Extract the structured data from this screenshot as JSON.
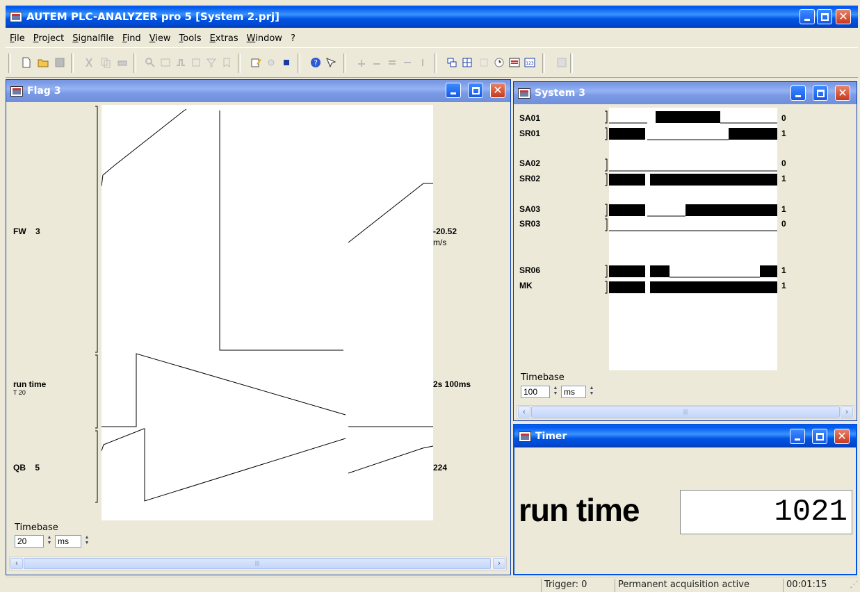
{
  "app": {
    "title": "AUTEM PLC-ANALYZER pro 5 [System 2.prj]"
  },
  "menu": [
    "File",
    "Project",
    "Signalfile",
    "Find",
    "View",
    "Tools",
    "Extras",
    "Window",
    "?"
  ],
  "windows": {
    "flag": {
      "title": "Flag 3",
      "signals": [
        {
          "name": "FW",
          "number": "3",
          "value": "-20.52",
          "unit": "m/s"
        },
        {
          "name": "run time",
          "sub": "T 20",
          "value": "2s 100ms"
        },
        {
          "name": "QB",
          "number": "5",
          "value": "224"
        }
      ],
      "timebase_label": "Timebase",
      "timebase_value": "20",
      "timebase_unit": "ms"
    },
    "system": {
      "title": "System 3",
      "signals": [
        {
          "name": "SA01",
          "value": "0"
        },
        {
          "name": "SR01",
          "value": "1"
        },
        {
          "name": "SA02",
          "value": "0"
        },
        {
          "name": "SR02",
          "value": "1"
        },
        {
          "name": "SA03",
          "value": "1"
        },
        {
          "name": "SR03",
          "value": "0"
        },
        {
          "name": "SR06",
          "value": "1"
        },
        {
          "name": "MK",
          "value": "1"
        }
      ],
      "timebase_label": "Timebase",
      "timebase_value": "100",
      "timebase_unit": "ms"
    },
    "timer": {
      "title": "Timer",
      "label": "run time",
      "value": "1021"
    }
  },
  "status": {
    "trigger": "Trigger: 0",
    "acquisition": "Permanent acquisition active",
    "time": "00:01:15"
  },
  "colors": {
    "active_title": "#0054e3",
    "inactive_title": "#7a96df",
    "close_button": "#c8381c"
  }
}
